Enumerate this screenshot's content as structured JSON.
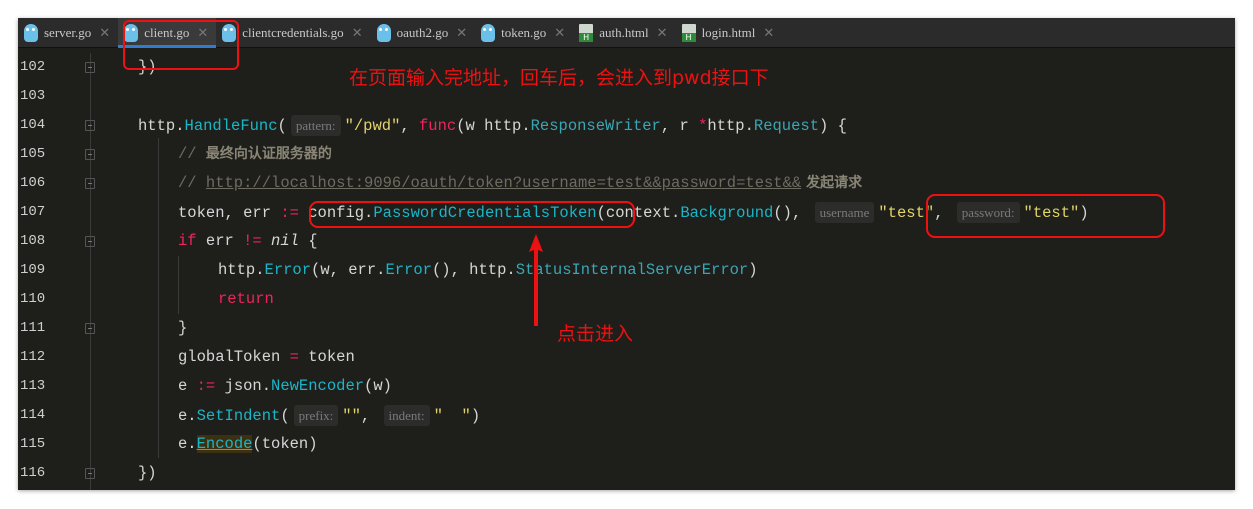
{
  "tabs": [
    {
      "label": "server.go",
      "icon": "gopher-icon",
      "active": false
    },
    {
      "label": "client.go",
      "icon": "gopher-icon",
      "active": true
    },
    {
      "label": "clientcredentials.go",
      "icon": "gopher-icon",
      "active": false
    },
    {
      "label": "oauth2.go",
      "icon": "gopher-icon",
      "active": false
    },
    {
      "label": "token.go",
      "icon": "gopher-icon",
      "active": false
    },
    {
      "label": "auth.html",
      "icon": "html-file-icon",
      "active": false
    },
    {
      "label": "login.html",
      "icon": "html-file-icon",
      "active": false
    }
  ],
  "code": [
    {
      "n": "102",
      "indent": 1,
      "fold": true,
      "tokens": [
        [
          "})",
          ""
        ]
      ]
    },
    {
      "n": "103",
      "indent": 0,
      "fold": false,
      "tokens": []
    },
    {
      "n": "104",
      "indent": 1,
      "fold": true,
      "tokens": [
        [
          "http.",
          ""
        ],
        [
          "HandleFunc",
          "fn"
        ],
        [
          "(",
          ""
        ],
        [
          "pattern:",
          "hint"
        ],
        [
          "\"/pwd\"",
          "str"
        ],
        [
          ", ",
          ""
        ],
        [
          "func",
          "kw"
        ],
        [
          "(w http.",
          ""
        ],
        [
          "ResponseWriter",
          "ty"
        ],
        [
          ", r ",
          ""
        ],
        [
          "*",
          "kw"
        ],
        [
          "http.",
          ""
        ],
        [
          "Request",
          "ty"
        ],
        [
          ") {",
          ""
        ]
      ]
    },
    {
      "n": "105",
      "indent": 2,
      "fold": true,
      "tokens": [
        [
          "// ",
          "cm"
        ],
        [
          "最终向认证服务器的",
          "cmz"
        ]
      ]
    },
    {
      "n": "106",
      "indent": 2,
      "fold": true,
      "tokens": [
        [
          "// ",
          "cm"
        ],
        [
          "http://localhost:9096/oauth/token?username=test&&password=test&&",
          "url"
        ],
        [
          " 发起请求",
          "cmz"
        ]
      ]
    },
    {
      "n": "107",
      "indent": 2,
      "fold": false,
      "tokens": [
        [
          "token, err ",
          ""
        ],
        [
          ":=",
          "kw"
        ],
        [
          " config.",
          ""
        ],
        [
          "PasswordCredentialsToken",
          "fn"
        ],
        [
          "(context.",
          ""
        ],
        [
          "Background",
          "fn"
        ],
        [
          "(), ",
          ""
        ],
        [
          "username",
          "hint"
        ],
        [
          "\"test\"",
          "str"
        ],
        [
          ", ",
          ""
        ],
        [
          "password:",
          "hint"
        ],
        [
          "\"test\"",
          "str"
        ],
        [
          ")",
          ""
        ]
      ]
    },
    {
      "n": "108",
      "indent": 2,
      "fold": true,
      "tokens": [
        [
          "if",
          "kw"
        ],
        [
          " err ",
          ""
        ],
        [
          "!=",
          "kw"
        ],
        [
          " ",
          ""
        ],
        [
          "nil",
          "it"
        ],
        [
          " {",
          ""
        ]
      ]
    },
    {
      "n": "109",
      "indent": 3,
      "fold": false,
      "tokens": [
        [
          "http.",
          ""
        ],
        [
          "Error",
          "fn"
        ],
        [
          "(w, err.",
          ""
        ],
        [
          "Error",
          "fn"
        ],
        [
          "(), http.",
          ""
        ],
        [
          "StatusInternalServerError",
          "ty"
        ],
        [
          ")",
          ""
        ]
      ]
    },
    {
      "n": "110",
      "indent": 3,
      "fold": false,
      "tokens": [
        [
          "return",
          "kw"
        ]
      ]
    },
    {
      "n": "111",
      "indent": 2,
      "fold": true,
      "tokens": [
        [
          "}",
          ""
        ]
      ]
    },
    {
      "n": "112",
      "indent": 2,
      "fold": false,
      "tokens": [
        [
          "globalToken ",
          ""
        ],
        [
          "=",
          "kw"
        ],
        [
          " token",
          ""
        ]
      ]
    },
    {
      "n": "113",
      "indent": 2,
      "fold": false,
      "tokens": [
        [
          "e ",
          ""
        ],
        [
          ":=",
          "kw"
        ],
        [
          " json.",
          ""
        ],
        [
          "NewEncoder",
          "fn"
        ],
        [
          "(w)",
          ""
        ]
      ]
    },
    {
      "n": "114",
      "indent": 2,
      "fold": false,
      "tokens": [
        [
          "e.",
          ""
        ],
        [
          "SetIndent",
          "fn"
        ],
        [
          "(",
          ""
        ],
        [
          "prefix:",
          "hint"
        ],
        [
          "\"\"",
          "str"
        ],
        [
          ", ",
          ""
        ],
        [
          "indent:",
          "hint"
        ],
        [
          "\"  \"",
          "str"
        ],
        [
          ")",
          ""
        ]
      ]
    },
    {
      "n": "115",
      "indent": 2,
      "fold": false,
      "tokens": [
        [
          "e.",
          ""
        ],
        [
          "Encode",
          "fn hl"
        ],
        [
          "(token)",
          ""
        ]
      ]
    },
    {
      "n": "116",
      "indent": 1,
      "fold": true,
      "tokens": [
        [
          "})",
          ""
        ]
      ]
    }
  ],
  "annotations": {
    "top_note": "在页面输入完地址，回车后，会进入到pwd接口下",
    "click_note": "点击进入",
    "color": "#ee1111"
  }
}
